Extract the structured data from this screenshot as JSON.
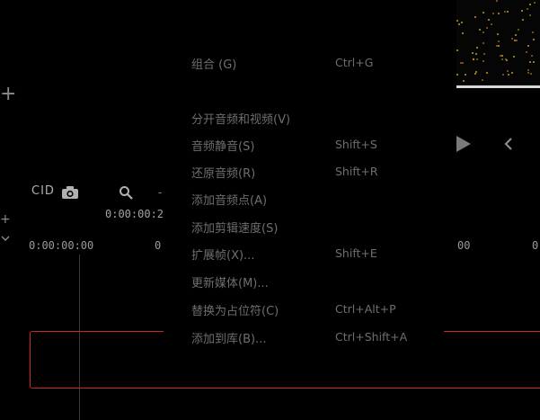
{
  "editor": {
    "toolbar": {
      "icons": [
        "closed-captions-icon",
        "camera-icon",
        "search-icon",
        "zoom-out-icon"
      ]
    },
    "transport": {
      "icons": [
        "play-icon",
        "step-back-icon"
      ]
    },
    "timeline": {
      "current_time": "0:00:00:2",
      "ruler": {
        "start": "0:00:00:00",
        "mark_0": "0",
        "mark_1": "00",
        "mark_2": "0"
      }
    },
    "colors": {
      "background": "#000000",
      "menu_text": "#6e6e6e",
      "clip_border": "#c8282c",
      "preview_accent": "#c79a1a"
    }
  },
  "context_menu": {
    "items": [
      {
        "label": "组合 (G)",
        "shortcut": "Ctrl+G"
      },
      {
        "label": "分开音频和视频(V)",
        "shortcut": ""
      },
      {
        "label": "音频静音(S)",
        "shortcut": "Shift+S"
      },
      {
        "label": "还原音频(R)",
        "shortcut": "Shift+R"
      },
      {
        "label": "添加音频点(A)",
        "shortcut": ""
      },
      {
        "label": "添加剪辑速度(S)",
        "shortcut": ""
      },
      {
        "label": "扩展帧(X)...",
        "shortcut": "Shift+E"
      },
      {
        "label": "更新媒体(M)...",
        "shortcut": ""
      },
      {
        "label": "替换为占位符(C)",
        "shortcut": "Ctrl+Alt+P"
      },
      {
        "label": "添加到库(B)...",
        "shortcut": "Ctrl+Shift+A"
      }
    ]
  }
}
